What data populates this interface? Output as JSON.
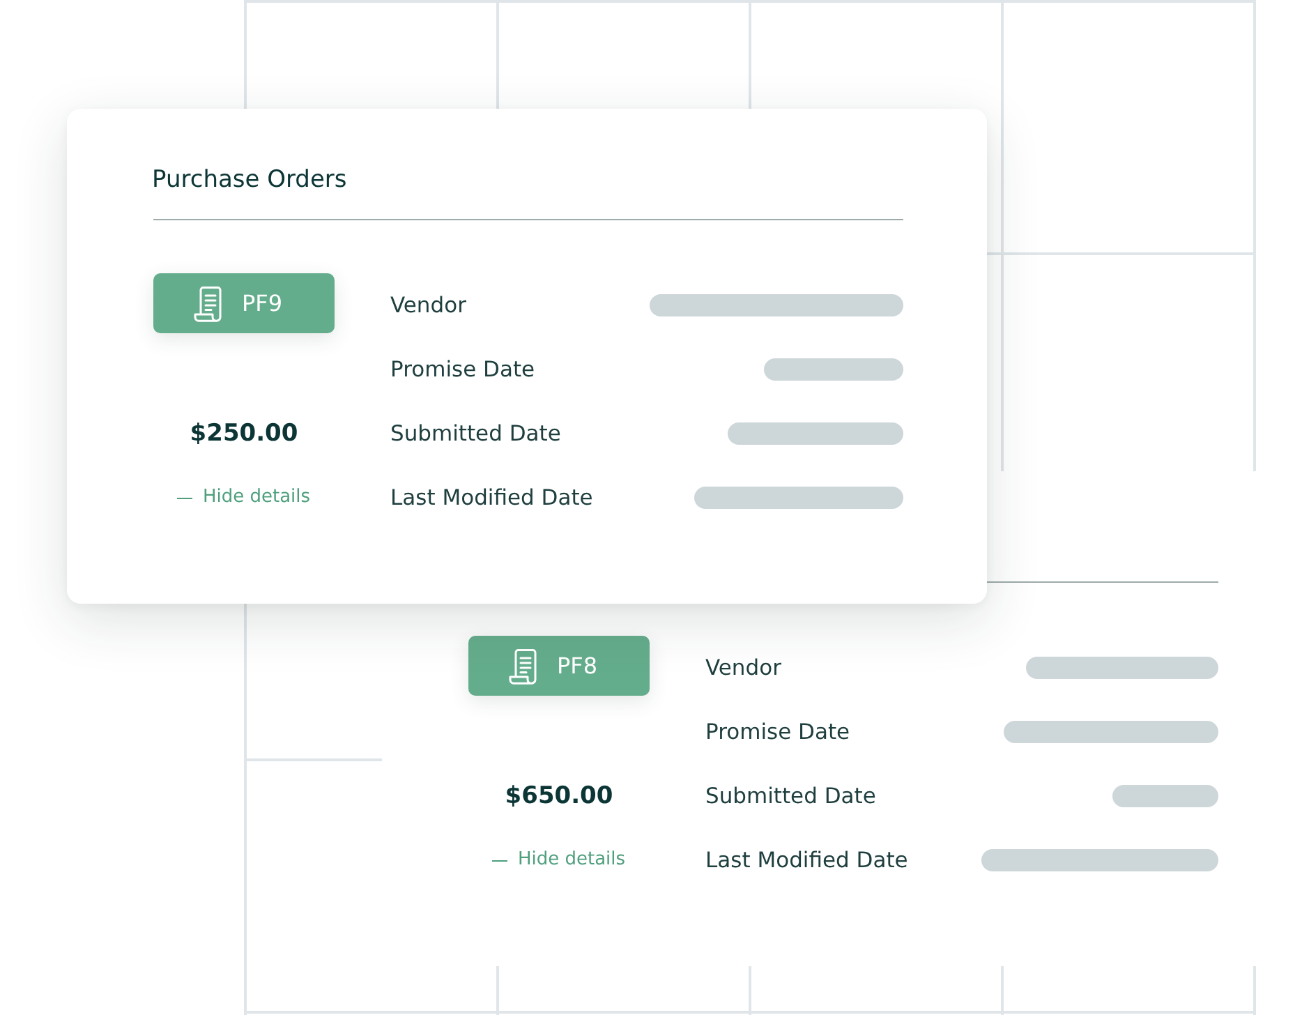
{
  "cards": [
    {
      "title": "Purchase Orders",
      "order": {
        "number": "PF9",
        "amount": "$250.00",
        "toggle": "Hide details",
        "expanded": true
      },
      "fields": [
        {
          "label": "Vendor"
        },
        {
          "label": "Promise Date"
        },
        {
          "label": "Submitted Date"
        },
        {
          "label": "Last Modified Date"
        }
      ]
    },
    {
      "order": {
        "number": "PF8",
        "amount": "$650.00",
        "toggle": "Hide details",
        "expanded": true
      },
      "fields": [
        {
          "label": "Vendor"
        },
        {
          "label": "Promise Date"
        },
        {
          "label": "Submitted Date"
        },
        {
          "label": "Last Modified Date"
        }
      ]
    }
  ]
}
